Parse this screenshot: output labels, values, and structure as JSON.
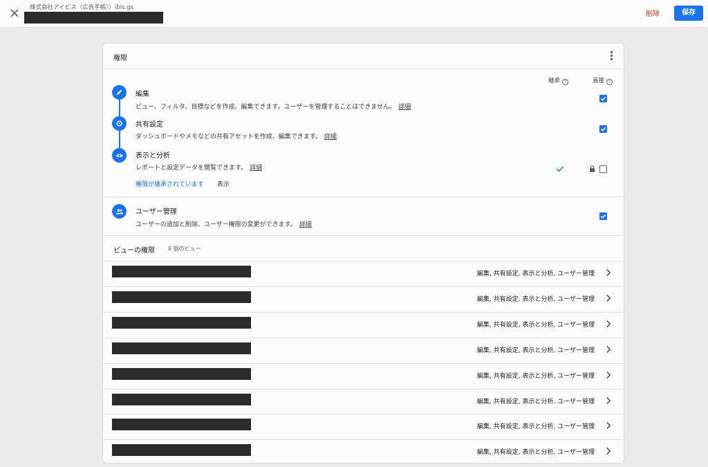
{
  "header": {
    "breadcrumb": "株式会社アイビス（広告手帳））ibis.gs",
    "delete_label": "削除",
    "save_label": "保存"
  },
  "card": {
    "title": "権限",
    "col_inherited": "継承",
    "col_direct": "直接",
    "detail_label": "詳細",
    "permissions": [
      {
        "title": "編集",
        "desc": "ビュー、フィルタ、目標などを作成、編集できます。ユーザーを管理することはできません。",
        "direct_checked": true
      },
      {
        "title": "共有設定",
        "desc": "ダッシュボードやメモなどの共有アセットを作成、編集できます。",
        "direct_checked": true
      },
      {
        "title": "表示と分析",
        "desc": "レポートと設定データを閲覧できます。",
        "direct_checked": false,
        "inherited": true,
        "locked": true
      },
      {
        "title": "ユーザー管理",
        "desc": "ユーザーの追加と削除、ユーザー権限の変更ができます。",
        "direct_checked": true
      }
    ],
    "inherited_link": "権限が継承されています",
    "show_label": "表示"
  },
  "views": {
    "title": "ビューの権限",
    "count": "8 個のビュー",
    "rows": [
      {
        "perms": "編集, 共有設定, 表示と分析, ユーザー管理"
      },
      {
        "perms": "編集, 共有設定, 表示と分析, ユーザー管理"
      },
      {
        "perms": "編集, 共有設定, 表示と分析, ユーザー管理"
      },
      {
        "perms": "編集, 共有設定, 表示と分析, ユーザー管理"
      },
      {
        "perms": "編集, 共有設定, 表示と分析, ユーザー管理"
      },
      {
        "perms": "編集, 共有設定, 表示と分析, ユーザー管理"
      },
      {
        "perms": "編集, 共有設定, 表示と分析, ユーザー管理"
      },
      {
        "perms": "編集, 共有設定, 表示と分析, ユーザー管理"
      }
    ]
  },
  "colors": {
    "accent": "#1a73e8",
    "danger": "#d93025",
    "redaction": "#2b2b2b"
  },
  "icons": {
    "close": "close-icon",
    "kebab": "more-vert-icon",
    "edit": "pencil-icon",
    "share": "share-icon",
    "view": "eye-icon",
    "users": "people-icon",
    "chevron": "chevron-right-icon",
    "lock": "lock-icon",
    "help": "help-icon"
  }
}
